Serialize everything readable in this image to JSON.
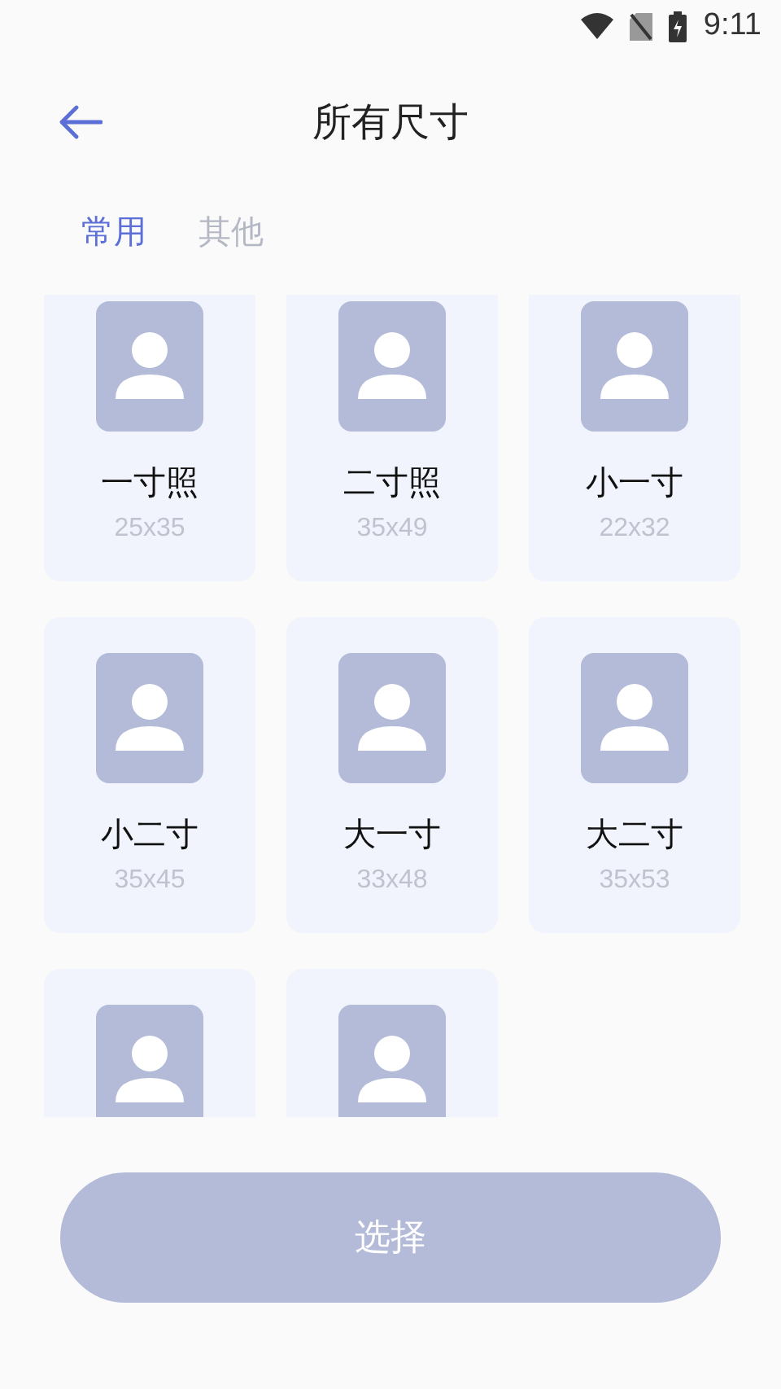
{
  "status_bar": {
    "time": "9:11"
  },
  "header": {
    "title": "所有尺寸"
  },
  "tabs": [
    {
      "label": "常用",
      "selected": true
    },
    {
      "label": "其他",
      "selected": false
    }
  ],
  "sizes": [
    {
      "kind": "full",
      "name": "一寸照",
      "size": "25x35"
    },
    {
      "kind": "full",
      "name": "二寸照",
      "size": "35x49"
    },
    {
      "kind": "full",
      "name": "小一寸",
      "size": "22x32"
    },
    {
      "kind": "full",
      "name": "小二寸",
      "size": "35x45"
    },
    {
      "kind": "full",
      "name": "大一寸",
      "size": "33x48"
    },
    {
      "kind": "full",
      "name": "大二寸",
      "size": "35x53"
    },
    {
      "kind": "partial"
    },
    {
      "kind": "partial"
    }
  ],
  "button": {
    "label": "选择"
  }
}
